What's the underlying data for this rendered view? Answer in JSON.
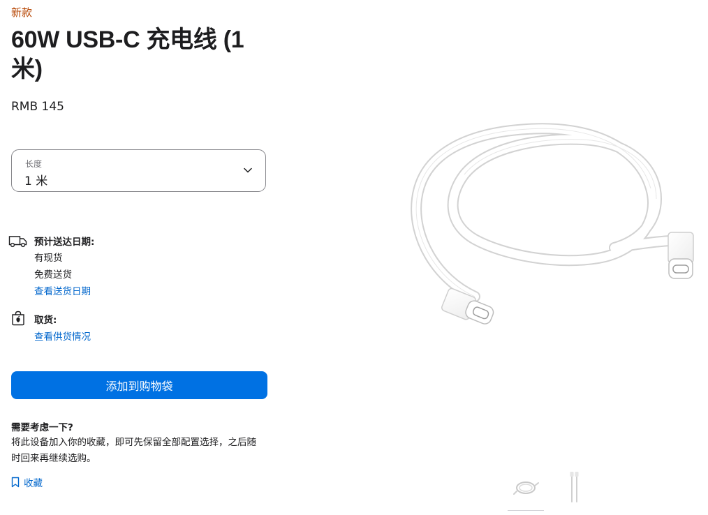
{
  "product": {
    "badge": "新款",
    "title": "60W USB-C 充电线 (1 米)",
    "price": "RMB 145"
  },
  "length_selector": {
    "label": "长度",
    "value": "1 米"
  },
  "delivery": {
    "icon": "truck-icon",
    "title": "预计送达日期:",
    "availability": "有现货",
    "shipping": "免费送货",
    "link": "查看送货日期"
  },
  "pickup": {
    "icon": "shopping-bag-icon",
    "title": "取货:",
    "link": "查看供货情况"
  },
  "actions": {
    "add_to_bag": "添加到购物袋",
    "save": "收藏"
  },
  "consider": {
    "title": "需要考虑一下?",
    "text": "将此设备加入你的收藏，即可先保留全部配置选择，之后随时回来再继续选购。"
  },
  "gallery": {
    "thumbnails": [
      "coiled-cable-thumbnail",
      "straight-cable-thumbnail"
    ]
  },
  "colors": {
    "badge": "#b64400",
    "link": "#0066cc",
    "button": "#0071e3",
    "text": "#1d1d1f"
  }
}
